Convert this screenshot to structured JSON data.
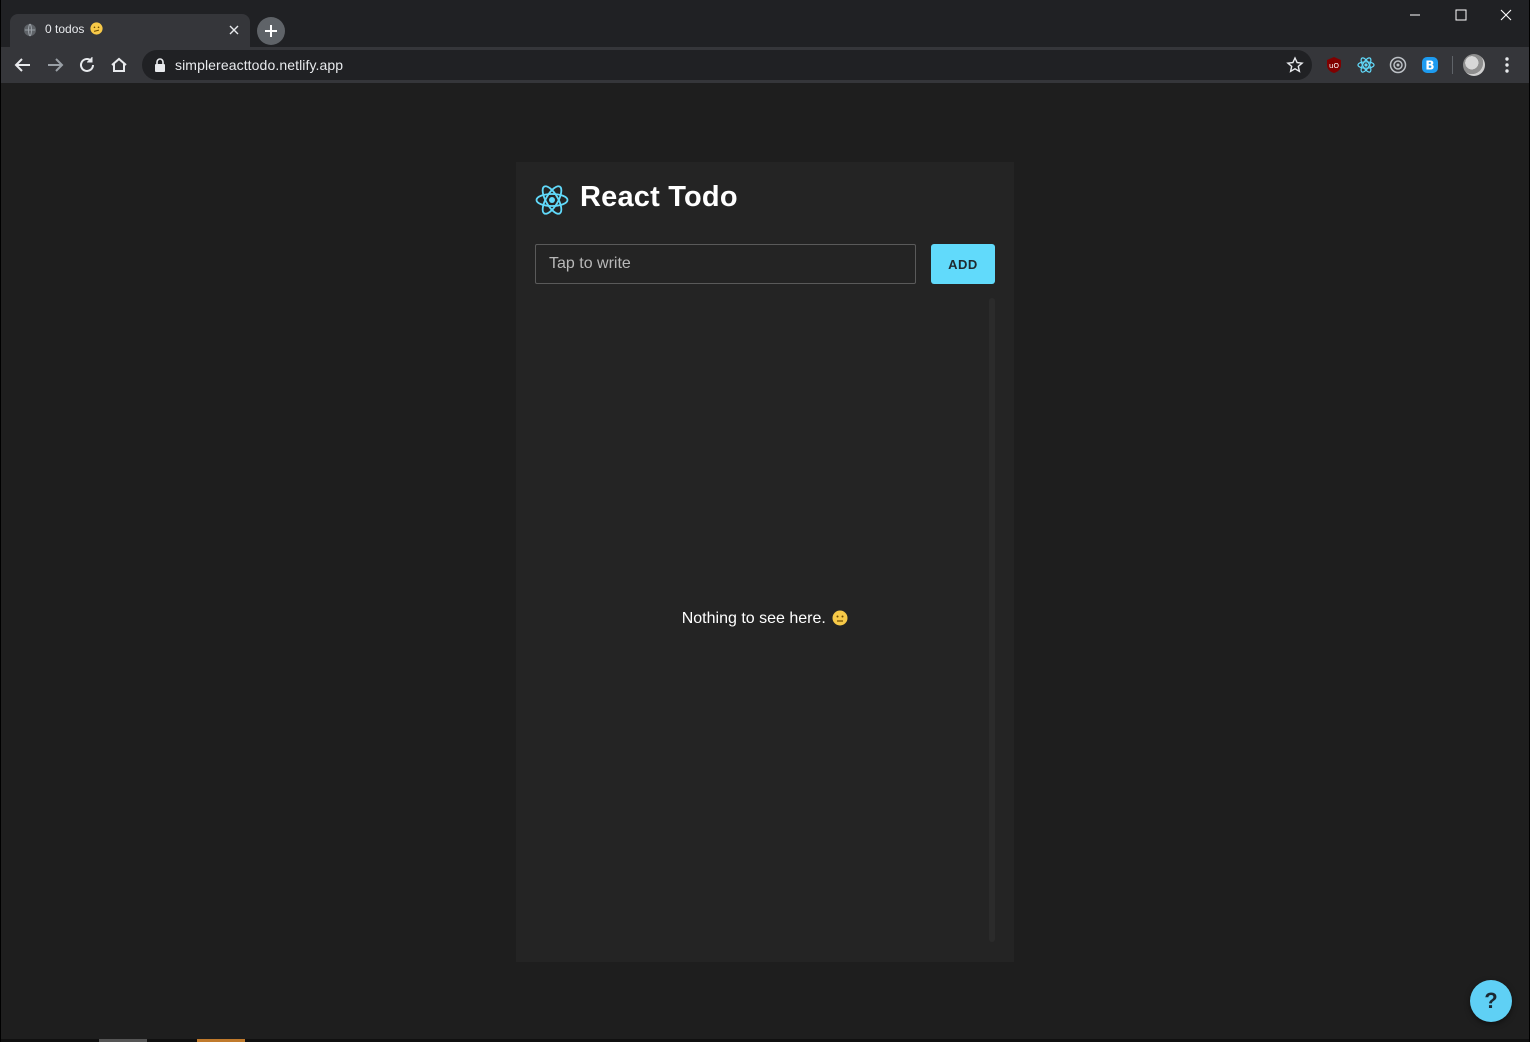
{
  "browser": {
    "tab": {
      "title": "0 todos"
    },
    "address": {
      "url": "simplereacttodo.netlify.app"
    },
    "icons": {
      "back": "arrow-left-icon",
      "forward": "arrow-right-icon",
      "reload": "reload-icon",
      "home": "home-icon",
      "secure": "lock-icon",
      "bookmark": "star-icon",
      "new_tab": "plus-icon",
      "menu": "kebab-menu-icon"
    },
    "extensions": [
      "ublock-origin-icon",
      "react-devtools-icon",
      "target-extension-icon",
      "b-extension-icon"
    ]
  },
  "app": {
    "title": "React Todo",
    "input": {
      "placeholder": "Tap to write",
      "value": ""
    },
    "add_label": "ADD",
    "empty_message": "Nothing to see here.",
    "help_label": "?",
    "todo_count": 0
  },
  "colors": {
    "accent": "#61dafb",
    "page_background": "#1e1e1e",
    "card_background": "#242424",
    "emoji": "#f7c948"
  }
}
